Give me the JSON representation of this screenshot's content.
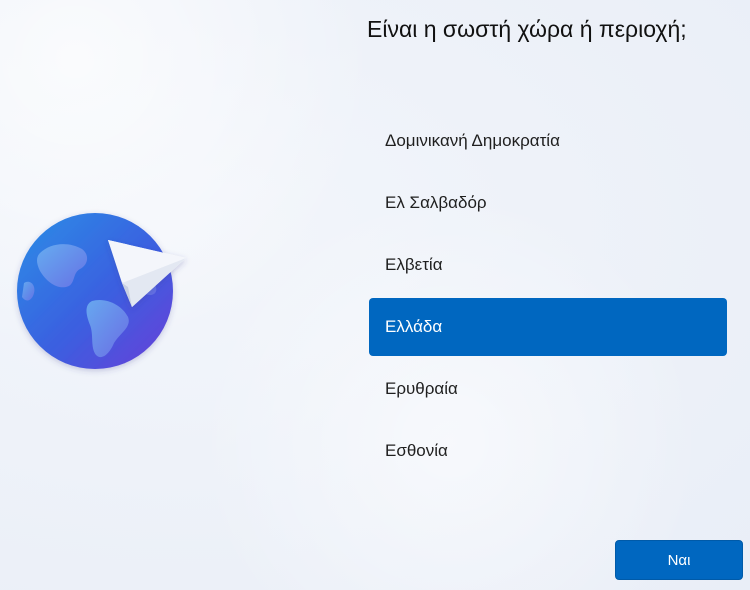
{
  "title": "Είναι η σωστή χώρα ή περιοχή;",
  "countries": [
    {
      "label": "Δομινικανή Δημοκρατία",
      "selected": false
    },
    {
      "label": "Ελ Σαλβαδόρ",
      "selected": false
    },
    {
      "label": "Ελβετία",
      "selected": false
    },
    {
      "label": "Ελλάδα",
      "selected": true
    },
    {
      "label": "Ερυθραία",
      "selected": false
    },
    {
      "label": "Εσθονία",
      "selected": false
    }
  ],
  "yes_button_label": "Ναι",
  "illustration_icon": "globe-with-paper-plane-icon",
  "colors": {
    "accent": "#0067c0",
    "globe_light": "#2d8ae0",
    "globe_dark": "#5b3fd6"
  }
}
